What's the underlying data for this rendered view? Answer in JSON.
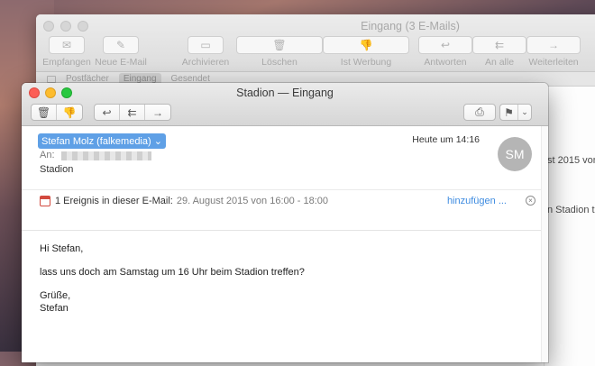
{
  "background_window": {
    "title": "Eingang (3 E-Mails)",
    "toolbar": [
      {
        "icon": "envelope-icon",
        "glyph": "✉",
        "label": "Empfangen"
      },
      {
        "icon": "compose-icon",
        "glyph": "✎",
        "label": "Neue E-Mail"
      },
      {
        "icon": "archive-icon",
        "glyph": "▭",
        "label": "Archivieren"
      },
      {
        "icon": "trash-icon",
        "glyph": "🗑",
        "label": "Löschen"
      },
      {
        "icon": "thumbs-down-icon",
        "glyph": "👎",
        "label": "Ist Werbung"
      },
      {
        "icon": "reply-icon",
        "glyph": "↩",
        "label": "Antworten"
      },
      {
        "icon": "reply-all-icon",
        "glyph": "⇇",
        "label": "An alle"
      },
      {
        "icon": "forward-icon",
        "glyph": "→",
        "label": "Weiterleiten"
      }
    ],
    "favorites": [
      "Postfächer",
      "Eingang",
      "Gesendet"
    ],
    "active_favorite": "Eingang",
    "snippets": [
      "st 2015 von",
      "n Stadion tre"
    ]
  },
  "message_window": {
    "title": "Stadion — Eingang",
    "sender": "Stefan Molz (falkemedia) ⌄",
    "to_label": "An:",
    "subject": "Stadion",
    "date": "Heute um 14:16",
    "avatar_initials": "SM",
    "event": {
      "count_text": "1 Ereignis in dieser E-Mail:",
      "date_text": "29. August 2015 von 16:00 - 18:00",
      "add_label": "hinzufügen ...",
      "close_glyph": "×"
    },
    "body": {
      "greeting": "Hi Stefan,",
      "text": "lass uns doch am Samstag um 16 Uhr beim Stadion treffen?",
      "closing": "Grüße,",
      "signature": "Stefan"
    },
    "toolbar_glyphs": {
      "delete": "🗑",
      "junk": "👎",
      "reply": "↩",
      "reply_all": "⇇",
      "forward": "→",
      "print": "⎙",
      "flag": "⚑",
      "menu": "⌄"
    }
  }
}
